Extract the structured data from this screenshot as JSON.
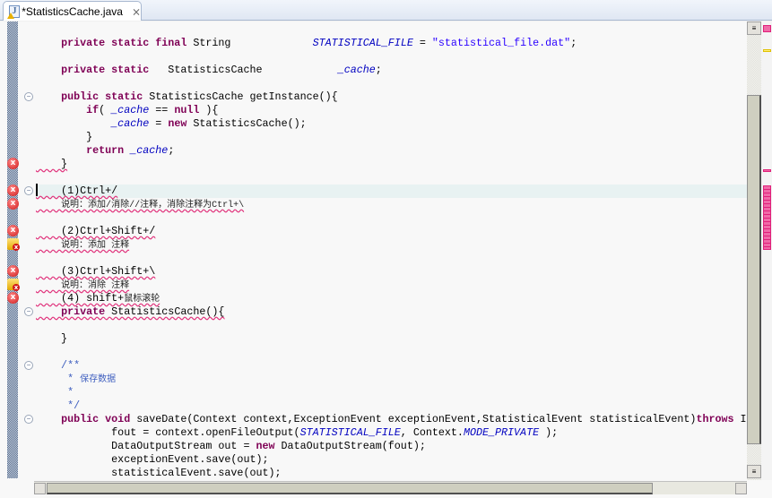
{
  "tab": {
    "title": "*StatisticsCache.java",
    "icon": "java-file-warning-icon",
    "close": "⨯"
  },
  "colors": {
    "keyword": "#7f0055",
    "field": "#0000c0",
    "string": "#2a00ff",
    "javadoc": "#3f5fbf",
    "current_line": "#e8f2f2",
    "error": "#d01818"
  },
  "lines": [
    {
      "n": 1,
      "segs": [
        [
          "    ",
          ""
        ],
        [
          "private static final",
          "kw"
        ],
        [
          " String             ",
          ""
        ],
        [
          "STATISTICAL_FILE",
          "fld"
        ],
        [
          " = ",
          ""
        ],
        [
          "\"statistical_file.dat\"",
          "str"
        ],
        [
          ";",
          ""
        ]
      ]
    },
    {
      "n": 3,
      "segs": [
        [
          "    ",
          ""
        ],
        [
          "private static",
          "kw"
        ],
        [
          "   StatisticsCache            ",
          ""
        ],
        [
          "_cache",
          "fld"
        ],
        [
          ";",
          ""
        ]
      ]
    },
    {
      "n": 5,
      "segs": [
        [
          "    ",
          ""
        ],
        [
          "public static",
          "kw"
        ],
        [
          " StatisticsCache getInstance(){",
          ""
        ]
      ]
    },
    {
      "n": 6,
      "segs": [
        [
          "        ",
          ""
        ],
        [
          "if",
          "kw"
        ],
        [
          "( ",
          ""
        ],
        [
          "_cache",
          "fld"
        ],
        [
          " == ",
          ""
        ],
        [
          "null",
          "kw"
        ],
        [
          " ){",
          ""
        ]
      ]
    },
    {
      "n": 7,
      "segs": [
        [
          "            ",
          ""
        ],
        [
          "_cache",
          "fld"
        ],
        [
          " = ",
          ""
        ],
        [
          "new",
          "kw"
        ],
        [
          " StatisticsCache();",
          ""
        ]
      ]
    },
    {
      "n": 8,
      "segs": [
        [
          "        }",
          ""
        ]
      ]
    },
    {
      "n": 9,
      "segs": [
        [
          "        ",
          ""
        ],
        [
          "return",
          "kw"
        ],
        [
          " ",
          ""
        ],
        [
          "_cache",
          "fld"
        ],
        [
          ";",
          ""
        ]
      ]
    },
    {
      "n": 10,
      "sq": true,
      "segs": [
        [
          "    }",
          ""
        ]
      ]
    },
    {
      "n": 12,
      "sq": true,
      "cur": true,
      "segs": [
        [
          "    (1)Ctrl+/",
          ""
        ]
      ]
    },
    {
      "n": 13,
      "sq": true,
      "segs": [
        [
          "    ",
          ""
        ],
        [
          "说明：添加/消除//注释，消除注释为Ctrl+\\",
          "cn"
        ]
      ]
    },
    {
      "n": 15,
      "sq": true,
      "segs": [
        [
          "    (2)Ctrl+Shift+/",
          ""
        ]
      ]
    },
    {
      "n": 16,
      "sq": true,
      "segs": [
        [
          "    ",
          ""
        ],
        [
          "说明：添加 注释",
          "cn"
        ]
      ]
    },
    {
      "n": 18,
      "sq": true,
      "segs": [
        [
          "    (3)Ctrl+Shift+\\",
          ""
        ]
      ]
    },
    {
      "n": 19,
      "sq": true,
      "segs": [
        [
          "    ",
          ""
        ],
        [
          "说明：消除 注释",
          "cn"
        ]
      ]
    },
    {
      "n": 20,
      "sq": true,
      "segs": [
        [
          "    (4) shift+",
          ""
        ],
        [
          "鼠标滚轮",
          "cn"
        ]
      ]
    },
    {
      "n": 21,
      "sq": true,
      "segs": [
        [
          "    ",
          ""
        ],
        [
          "private",
          "kw"
        ],
        [
          " StatisticsCache(){",
          ""
        ]
      ]
    },
    {
      "n": 23,
      "segs": [
        [
          "    }",
          ""
        ]
      ]
    },
    {
      "n": 25,
      "segs": [
        [
          "    /**",
          "doc"
        ]
      ]
    },
    {
      "n": 26,
      "segs": [
        [
          "     * ",
          "doc"
        ],
        [
          "保存数据",
          "cn doc"
        ]
      ]
    },
    {
      "n": 27,
      "segs": [
        [
          "     *",
          "doc"
        ]
      ]
    },
    {
      "n": 28,
      "segs": [
        [
          "     */",
          "doc"
        ]
      ]
    },
    {
      "n": 29,
      "segs": [
        [
          "    ",
          ""
        ],
        [
          "public void",
          "kw"
        ],
        [
          " saveDate(Context context,ExceptionEvent exceptionEvent,StatisticalEvent statisticalEvent)",
          ""
        ],
        [
          "throws",
          "kw"
        ],
        [
          " IOException",
          ""
        ]
      ]
    },
    {
      "n": 30,
      "segs": [
        [
          "            fout = context.openFileOutput(",
          ""
        ],
        [
          "STATISTICAL_FILE",
          "fld"
        ],
        [
          ", Context.",
          ""
        ],
        [
          "MODE_PRIVATE",
          "fld"
        ],
        [
          " );",
          ""
        ]
      ]
    },
    {
      "n": 31,
      "segs": [
        [
          "            DataOutputStream out = ",
          ""
        ],
        [
          "new",
          "kw"
        ],
        [
          " DataOutputStream(fout);",
          ""
        ]
      ]
    },
    {
      "n": 32,
      "segs": [
        [
          "            exceptionEvent.save(out);",
          ""
        ]
      ]
    },
    {
      "n": 33,
      "segs": [
        [
          "            statisticalEvent.save(out);",
          ""
        ]
      ]
    }
  ],
  "markers": [
    {
      "line": 10,
      "type": "error"
    },
    {
      "line": 12,
      "type": "error"
    },
    {
      "line": 13,
      "type": "error"
    },
    {
      "line": 15,
      "type": "error"
    },
    {
      "line": 16,
      "type": "warning-error"
    },
    {
      "line": 18,
      "type": "error"
    },
    {
      "line": 19,
      "type": "warning-error"
    },
    {
      "line": 20,
      "type": "error"
    }
  ],
  "folds": [
    5,
    12,
    21,
    25,
    29
  ],
  "cursor_line": 12
}
